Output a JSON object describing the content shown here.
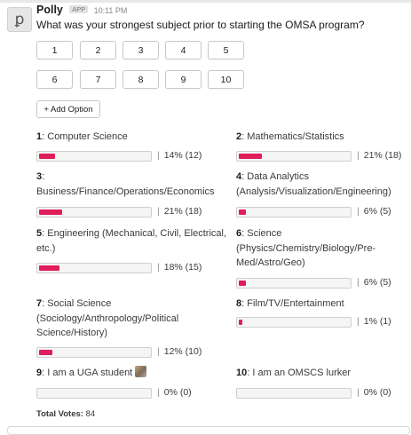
{
  "message": {
    "sender": "Polly",
    "app_badge": "APP",
    "time": "10:11 PM",
    "question": "What was your strongest subject prior to starting the OMSA program?"
  },
  "vote_buttons": [
    "1",
    "2",
    "3",
    "4",
    "5",
    "6",
    "7",
    "8",
    "9",
    "10"
  ],
  "add_option_label": "+ Add Option",
  "options": [
    {
      "num": "1",
      "label": "Computer Science",
      "fraction": 0.14,
      "result": "14% (12)"
    },
    {
      "num": "2",
      "label": "Mathematics/Statistics",
      "fraction": 0.21,
      "result": "21% (18)"
    },
    {
      "num": "3",
      "label": "Business/Finance/Operations/Economics",
      "fraction": 0.21,
      "result": "21% (18)"
    },
    {
      "num": "4",
      "label": "Data Analytics (Analysis/Visualization/Engineering)",
      "fraction": 0.06,
      "result": "6% (5)"
    },
    {
      "num": "5",
      "label": "Engineering (Mechanical, Civil, Electrical, etc.)",
      "fraction": 0.18,
      "result": "18% (15)"
    },
    {
      "num": "6",
      "label": "Science (Physics/Chemistry/Biology/Pre-Med/Astro/Geo)",
      "fraction": 0.06,
      "result": "6% (5)"
    },
    {
      "num": "7",
      "label": "Social Science (Sociology/Anthropology/Political Science/History)",
      "fraction": 0.12,
      "result": "12% (10)"
    },
    {
      "num": "8",
      "label": "Film/TV/Entertainment",
      "fraction": 0.01,
      "result": "1% (1)"
    },
    {
      "num": "9",
      "label": "I am a UGA student",
      "fraction": 0,
      "result": "0% (0)"
    },
    {
      "num": "10",
      "label": "I am an OMSCS lurker",
      "fraction": 0,
      "result": "0% (0)"
    }
  ],
  "total_votes": {
    "label": "Total Votes:",
    "value": "84"
  },
  "colors": {
    "bar_fill": "#e01e5a",
    "bar_track": "#f5f5f5"
  }
}
